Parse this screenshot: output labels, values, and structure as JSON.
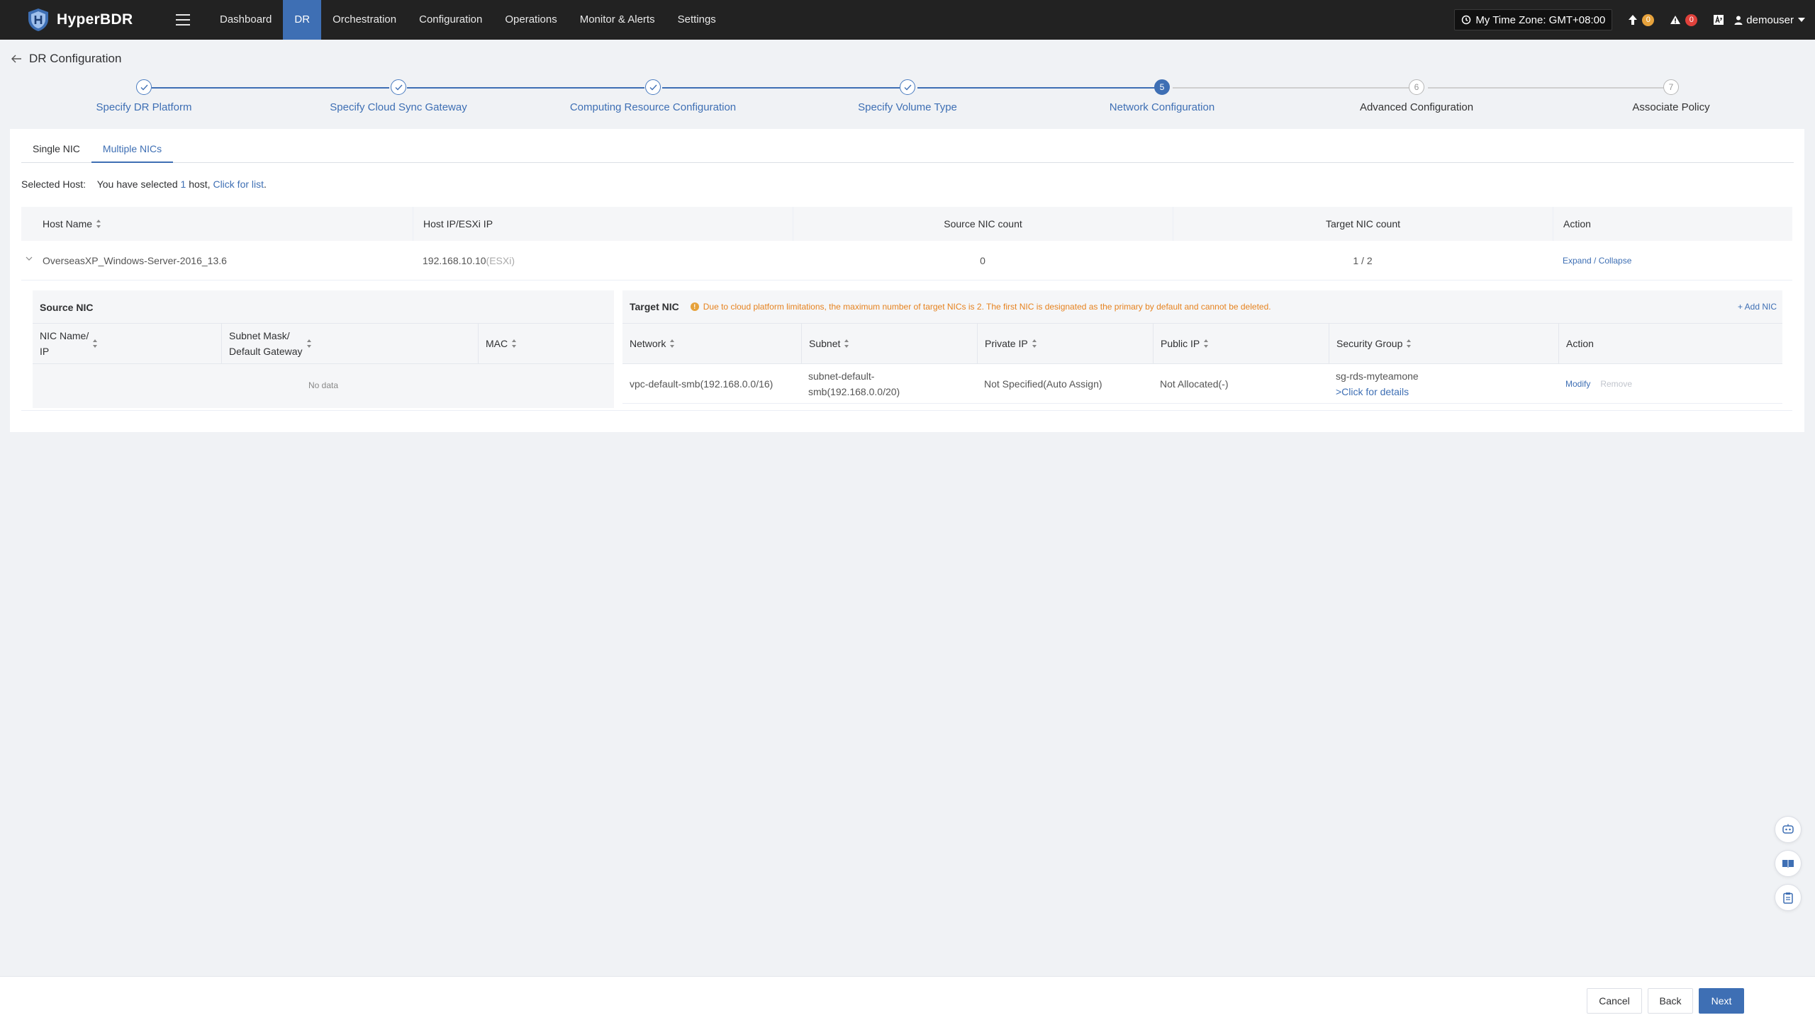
{
  "app": {
    "name": "HyperBDR"
  },
  "nav": {
    "menu": [
      {
        "label": "Dashboard",
        "active": false
      },
      {
        "label": "DR",
        "active": true
      },
      {
        "label": "Orchestration",
        "active": false
      },
      {
        "label": "Configuration",
        "active": false
      },
      {
        "label": "Operations",
        "active": false
      },
      {
        "label": "Monitor & Alerts",
        "active": false
      },
      {
        "label": "Settings",
        "active": false
      }
    ],
    "timezone": "My Time Zone: GMT+08:00",
    "upgrade_count": "0",
    "alert_count": "0",
    "username": "demouser"
  },
  "page": {
    "title": "DR Configuration"
  },
  "steps": [
    {
      "number": "1",
      "label": "Specify DR Platform",
      "status": "done"
    },
    {
      "number": "2",
      "label": "Specify Cloud Sync Gateway",
      "status": "done"
    },
    {
      "number": "3",
      "label": "Computing Resource Configuration",
      "status": "done"
    },
    {
      "number": "4",
      "label": "Specify Volume Type",
      "status": "done"
    },
    {
      "number": "5",
      "label": "Network Configuration",
      "status": "current"
    },
    {
      "number": "6",
      "label": "Advanced Configuration",
      "status": "future"
    },
    {
      "number": "7",
      "label": "Associate Policy",
      "status": "future"
    }
  ],
  "tabs": [
    {
      "label": "Single NIC",
      "active": false
    },
    {
      "label": "Multiple NICs",
      "active": true
    }
  ],
  "selected_host": {
    "label": "Selected Host:",
    "prefix": "You have selected",
    "count": "1",
    "suffix": "host,",
    "link": "Click for list",
    "end": "."
  },
  "host_table": {
    "columns": [
      "Host Name",
      "Host IP/ESXi IP",
      "Source NIC count",
      "Target NIC count",
      "Action"
    ],
    "row": {
      "host_name": "OverseasXP_Windows-Server-2016_13.6",
      "ip": "192.168.10.10",
      "ip_tag": "(ESXi)",
      "source_nic_count": "0",
      "target_nic_count": "1 / 2",
      "action": "Expand / Collapse"
    }
  },
  "source_nic": {
    "title": "Source NIC",
    "columns": {
      "name_ip_1": "NIC Name/",
      "name_ip_2": "IP",
      "mask_gw_1": "Subnet Mask/",
      "mask_gw_2": "Default Gateway",
      "mac": "MAC"
    },
    "empty": "No data"
  },
  "target_nic": {
    "title": "Target NIC",
    "warning": "Due to cloud platform limitations, the maximum number of target NICs is 2. The first NIC is designated as the primary by default and cannot be deleted.",
    "add_label": "+ Add NIC",
    "columns": [
      "Network",
      "Subnet",
      "Private IP",
      "Public IP",
      "Security Group",
      "Action"
    ],
    "rows": [
      {
        "network": "vpc-default-smb(192.168.0.0/16)",
        "subnet_1": "subnet-default-",
        "subnet_2": "smb(192.168.0.0/20)",
        "private_ip": "Not Specified(Auto Assign)",
        "public_ip": "Not Allocated(-)",
        "security_group": "sg-rds-myteamone",
        "security_link": ">Click for details",
        "modify": "Modify",
        "remove": "Remove"
      }
    ]
  },
  "footer": {
    "cancel": "Cancel",
    "back": "Back",
    "next": "Next"
  },
  "icons": {
    "logo": "shield-logo-icon",
    "menu": "hamburger-icon",
    "clock": "clock-icon",
    "upgrade": "arrow-up-icon",
    "alert": "warning-triangle-icon",
    "lang": "language-icon",
    "user": "user-icon",
    "back": "arrow-left-icon",
    "side": [
      "robot-assistant-icon",
      "book-icon",
      "clipboard-icon"
    ]
  },
  "colors": {
    "accent": "#3e6fb4",
    "nav_bg": "#222222",
    "warning": "#e6821e",
    "badge_orange": "#e6a23c",
    "badge_red": "#e0413b"
  }
}
